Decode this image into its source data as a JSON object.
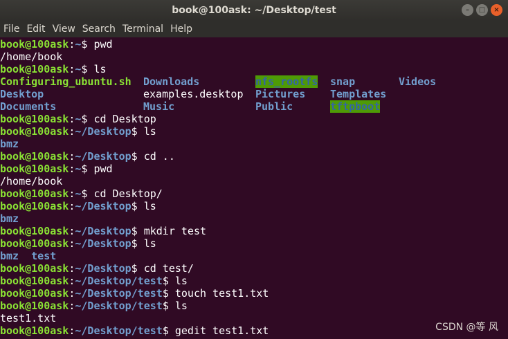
{
  "window": {
    "title": "book@100ask: ~/Desktop/test",
    "controls": {
      "minimize": "–",
      "maximize": "□",
      "close": "×"
    }
  },
  "menu": [
    "File",
    "Edit",
    "View",
    "Search",
    "Terminal",
    "Help"
  ],
  "prompt": {
    "user_host": "book@100ask"
  },
  "lines": [
    {
      "path": "~",
      "cmd": "pwd"
    },
    {
      "out": "/home/book"
    },
    {
      "path": "~",
      "cmd": "ls"
    },
    {
      "ls": [
        "Configuring_ubuntu.sh",
        "Downloads",
        "nfs_rootfs",
        "snap",
        "Videos"
      ]
    },
    {
      "ls": [
        "Desktop",
        "examples.desktop",
        "Pictures",
        "Templates"
      ]
    },
    {
      "ls": [
        "Documents",
        "Music",
        "Public",
        "tftpboot"
      ]
    },
    {
      "path": "~",
      "cmd": "cd Desktop"
    },
    {
      "path": "~/Desktop",
      "cmd": "ls"
    },
    {
      "dirs": "bmz"
    },
    {
      "path": "~/Desktop",
      "cmd": "cd .."
    },
    {
      "path": "~",
      "cmd": "pwd"
    },
    {
      "out": "/home/book"
    },
    {
      "path": "~",
      "cmd": "cd Desktop/"
    },
    {
      "path": "~/Desktop",
      "cmd": "ls"
    },
    {
      "dirs": "bmz"
    },
    {
      "path": "~/Desktop",
      "cmd": "mkdir test"
    },
    {
      "path": "~/Desktop",
      "cmd": "ls"
    },
    {
      "dirs": "bmz  test"
    },
    {
      "path": "~/Desktop",
      "cmd": "cd test/"
    },
    {
      "path": "~/Desktop/test",
      "cmd": "ls"
    },
    {
      "path": "~/Desktop/test",
      "cmd": "touch test1.txt"
    },
    {
      "path": "~/Desktop/test",
      "cmd": "ls"
    },
    {
      "out": "test1.txt"
    },
    {
      "path": "~/Desktop/test",
      "cmd": "gedit test1.txt"
    }
  ],
  "watermark": "CSDN @等    风",
  "colors": {
    "user": "#8ae234",
    "path": "#729fcf",
    "highlight_bg": "#4e9a06",
    "background": "#300a24"
  }
}
